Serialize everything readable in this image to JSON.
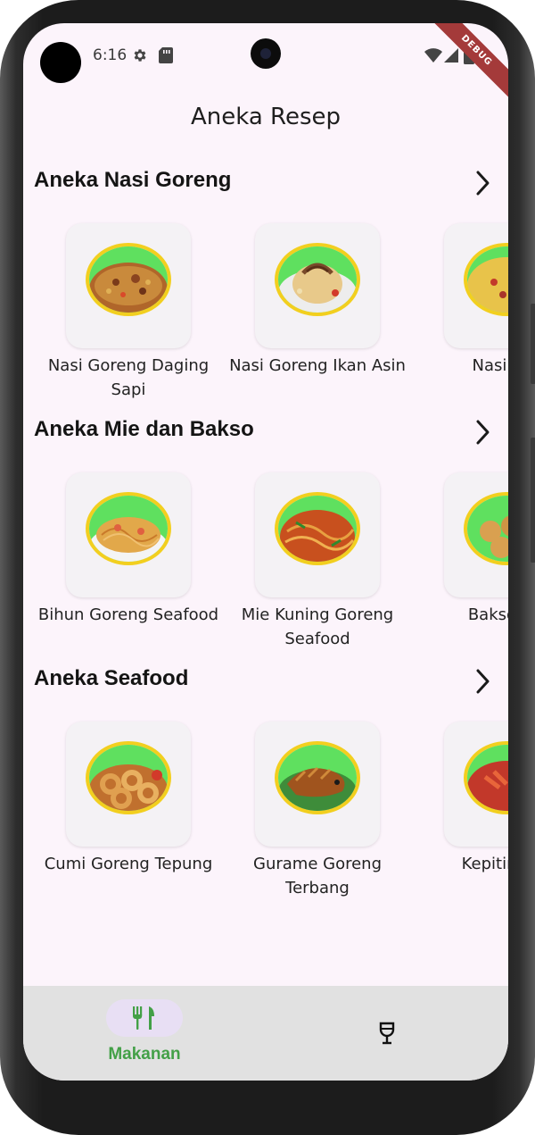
{
  "status_bar": {
    "time": "6:16",
    "icons": [
      "gear-icon",
      "sd-card-icon",
      "wifi-icon",
      "signal-icon",
      "battery-icon"
    ],
    "debug_label": "DEBUG"
  },
  "app": {
    "title": "Aneka Resep"
  },
  "sections": [
    {
      "title": "Aneka Nasi Goreng",
      "items": [
        {
          "label": "Nasi Goreng Daging Sapi",
          "label_lines": [
            "Nasi Goreng Daging",
            "Sapi"
          ]
        },
        {
          "label": "Nasi Goreng Ikan Asin",
          "label_lines": [
            "Nasi Goreng Ikan Asin"
          ]
        },
        {
          "label": "Nasi Gor",
          "label_lines": [
            "Nasi Gor"
          ]
        }
      ]
    },
    {
      "title": "Aneka Mie dan Bakso",
      "items": [
        {
          "label": "Bihun Goreng Seafood",
          "label_lines": [
            "Bihun Goreng Seafood"
          ]
        },
        {
          "label": "Mie Kuning Goreng Seafood",
          "label_lines": [
            "Mie Kuning Goreng",
            "Seafood"
          ]
        },
        {
          "label": "Bakso Ika",
          "label_lines": [
            "Bakso Ika"
          ]
        }
      ]
    },
    {
      "title": "Aneka Seafood",
      "items": [
        {
          "label": "Cumi Goreng Tepung",
          "label_lines": [
            "Cumi Goreng Tepung"
          ]
        },
        {
          "label": "Gurame Goreng Terbang",
          "label_lines": [
            "Gurame Goreng",
            "Terbang"
          ]
        },
        {
          "label": "Kepiting As",
          "label_lines": [
            "Kepiting As"
          ]
        }
      ]
    }
  ],
  "bottom_nav": {
    "items": [
      {
        "label": "Makanan",
        "icon": "utensils-icon",
        "selected": true
      },
      {
        "label": "",
        "icon": "wine-glass-icon",
        "selected": false
      }
    ]
  },
  "colors": {
    "background": "#fcf4fb",
    "accent_green": "#43a047",
    "image_border": "#f2cf1f",
    "image_bg": "#66e066",
    "nav_bg": "#e1e1e1",
    "nav_pill": "#e8dff4",
    "debug_ribbon": "#a43a3a"
  }
}
